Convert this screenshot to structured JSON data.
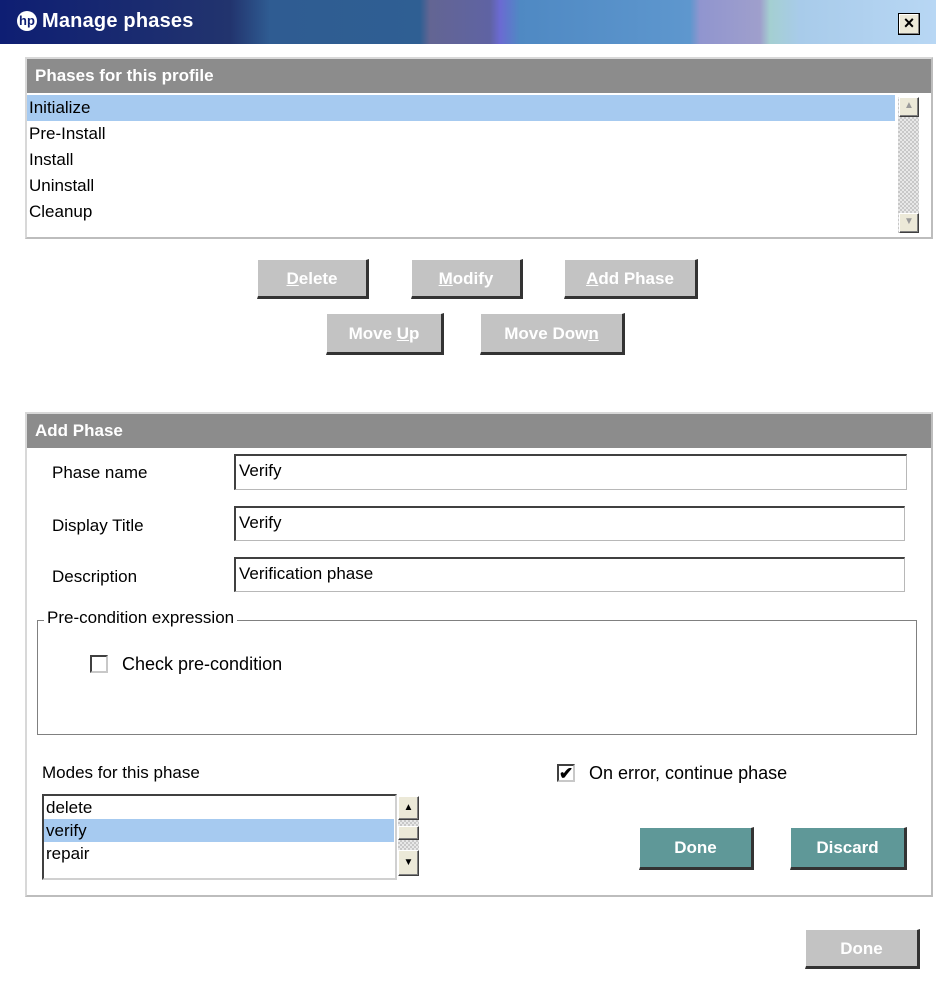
{
  "window": {
    "title": "Manage phases",
    "icon": "hp-logo-icon",
    "close_glyph": "×"
  },
  "phases_group": {
    "header": "Phases for this profile",
    "items": [
      "Initialize",
      "Pre-Install",
      "Install",
      "Uninstall",
      "Cleanup"
    ],
    "selected_index": 0
  },
  "phase_buttons": {
    "delete": {
      "pre": "",
      "key": "D",
      "post": "elete"
    },
    "modify": {
      "pre": "",
      "key": "M",
      "post": "odify"
    },
    "add_phase": {
      "pre": "",
      "key": "A",
      "post": "dd Phase"
    },
    "move_up": {
      "pre": "Move ",
      "key": "U",
      "post": "p"
    },
    "move_down": {
      "pre": "Move Dow",
      "key": "n",
      "post": ""
    }
  },
  "add_phase_group": {
    "header": "Add Phase",
    "phase_name_label": "Phase name",
    "phase_name_value": "Verify",
    "display_title_label": "Display Title",
    "display_title_value": "Verify",
    "description_label": "Description",
    "description_value": "Verification phase",
    "precondition_legend": "Pre-condition expression",
    "check_precondition_label": "Check pre-condition",
    "check_precondition_checked": false,
    "modes_label": "Modes for this phase",
    "modes": [
      "delete",
      "verify",
      "repair"
    ],
    "modes_selected_index": 1,
    "on_error_label": "On error, continue phase",
    "on_error_checked": true,
    "done_label": "Done",
    "discard_label": "Discard"
  },
  "footer": {
    "done_label": "Done"
  },
  "colors": {
    "selection": "#a6caf0",
    "header_gray": "#8c8c8c",
    "teal_button": "#5f9898",
    "disabled_button": "#c3c3c3"
  }
}
